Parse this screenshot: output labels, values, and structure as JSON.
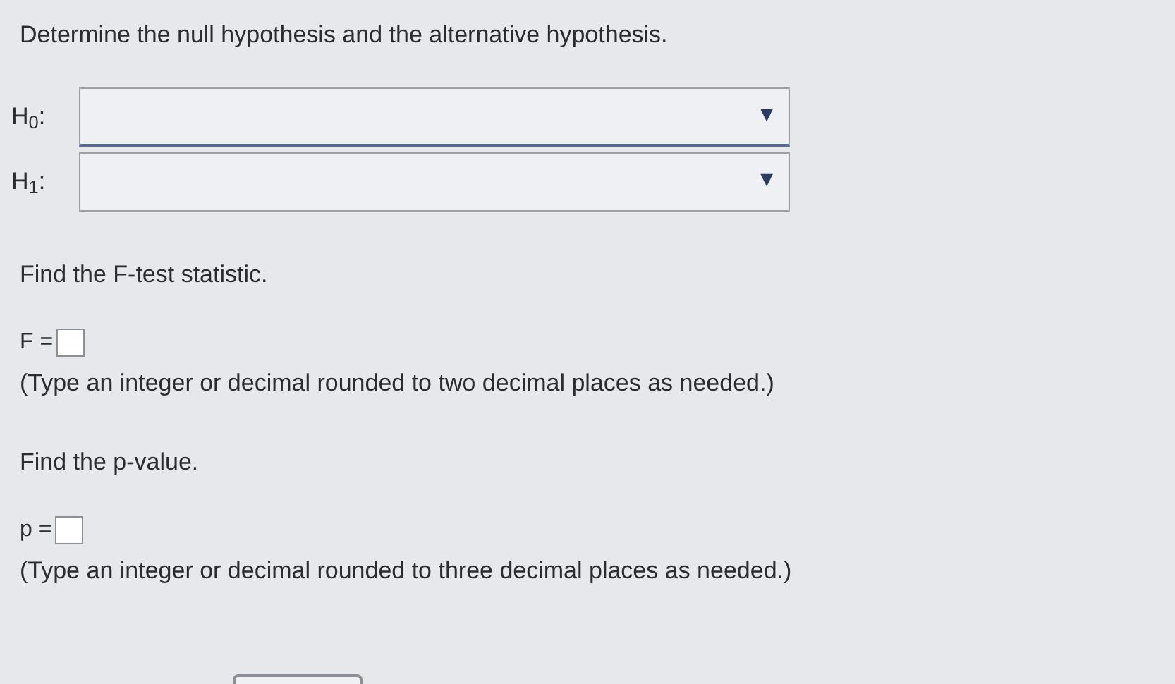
{
  "heading": "Determine the null hypothesis and the alternative hypothesis.",
  "hypotheses": [
    {
      "label": "H$_{0}$:",
      "arrow": "▼"
    },
    {
      "label": "H$_{1}$:",
      "arrow": "▼"
    }
  ],
  "questions": [
    {
      "prompt": "Find the F-test statistic.",
      "label": "F =",
      "note": "(Type an integer or decimal rounded to two decimal places as needed.)"
    },
    {
      "prompt": "Find the p-value.",
      "label": "p =",
      "note": "(Type an integer or decimal rounded to three decimal places as needed.)"
    }
  ]
}
